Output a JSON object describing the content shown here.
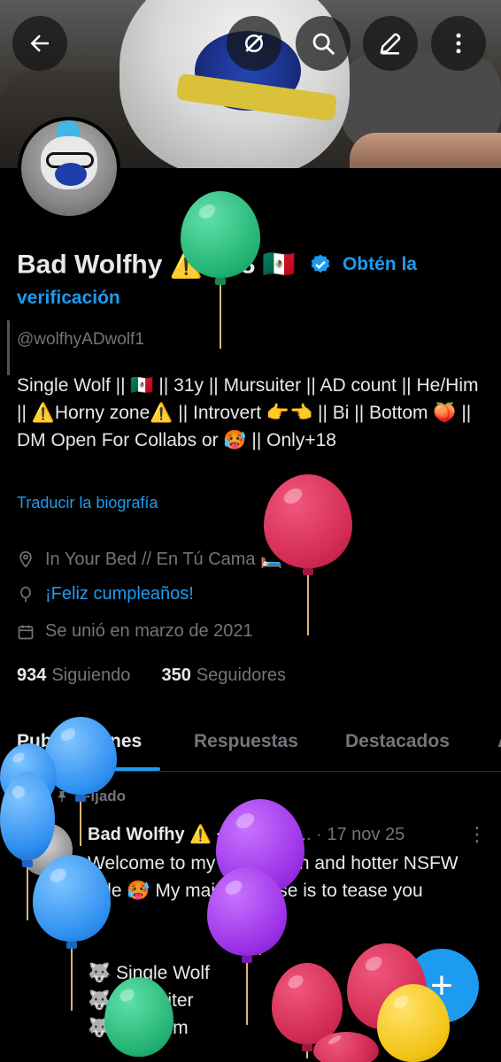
{
  "header": {
    "back_icon": "arrow-left-icon",
    "actions": [
      "no-connection-icon",
      "search-icon",
      "edit-icon",
      "more-vertical-icon"
    ]
  },
  "profile": {
    "name": "Bad Wolfhy ⚠️ +18 🇲🇽",
    "get_verified": "Obtén la verificación",
    "handle": "@wolfhyADwolf1",
    "bio": "Single Wolf || 🇲🇽 || 31y || Mursuiter || AD count || He/Him || ⚠️Horny zone⚠️ || Introvert 👉👈 || Bi || Bottom 🍑 || DM Open For Collabs or 🥵 || Only+18",
    "translate_bio": "Traducir la biografía",
    "location": "In Your Bed // En Tú Cama 🛏️",
    "birthday": "¡Feliz cumpleaños!",
    "joined": "Se unió en marzo de 2021",
    "following_count": "934",
    "following_label": "Siguiendo",
    "followers_count": "350",
    "followers_label": "Seguidores",
    "accent_color": "#1d9bf0"
  },
  "tabs": [
    {
      "label": "Publicaciones",
      "active": true
    },
    {
      "label": "Respuestas",
      "active": false
    },
    {
      "label": "Destacados",
      "active": false
    },
    {
      "label": "A",
      "active": false
    }
  ],
  "pinned_post": {
    "pinned_label": "Fijado",
    "author": "Bad Wolfhy ⚠️ +18 🇲🇽",
    "handle_truncated": "@...",
    "date": "· 17 nov 25",
    "text": "Welcome to my more open and hotter NSFW side 🥵 My main purpose is to tease you",
    "list": [
      "🐺 Single Wolf",
      "🐺 Mursuiter",
      "🐺 He / Him"
    ]
  },
  "fab": {
    "icon": "plus-icon",
    "label": "+"
  }
}
